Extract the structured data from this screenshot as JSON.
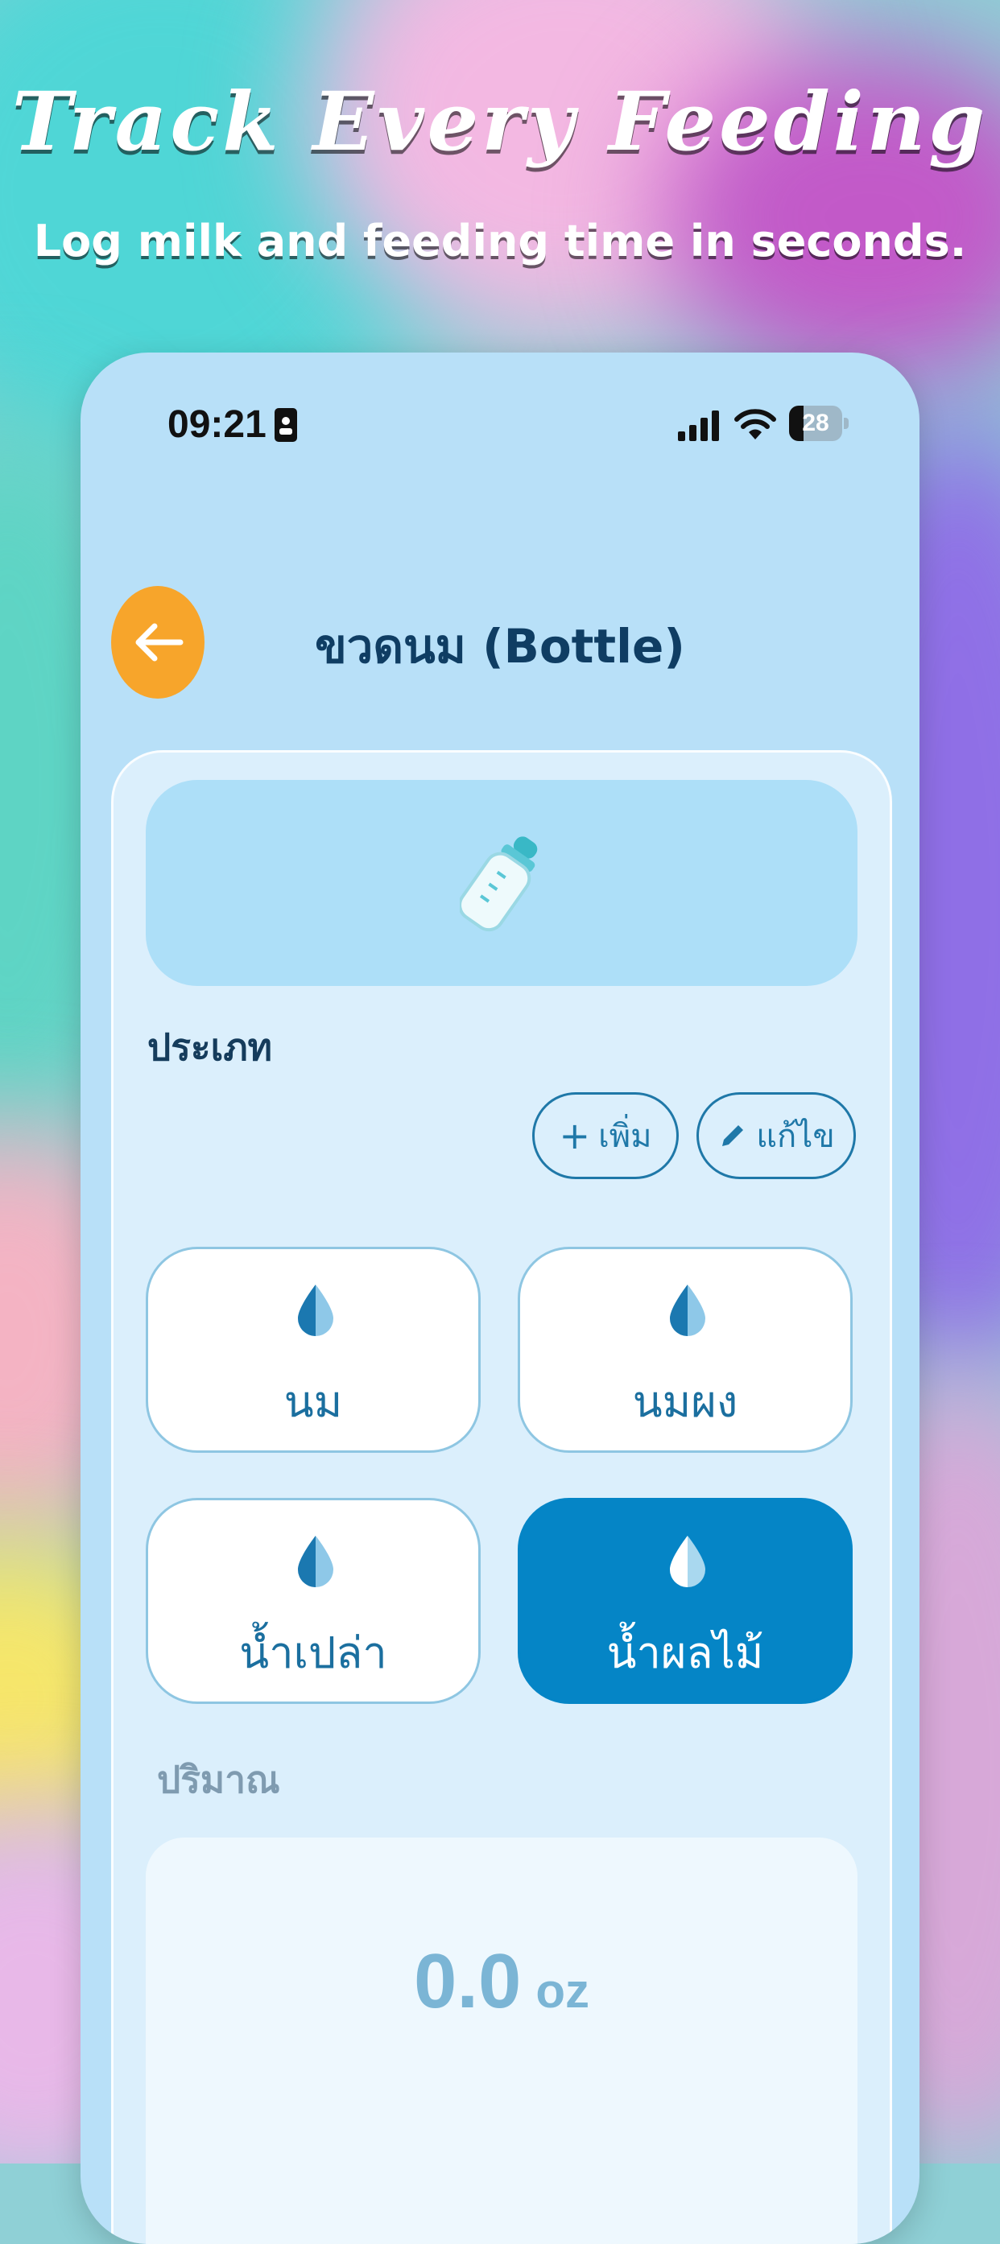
{
  "promo": {
    "title": "Track Every Feeding",
    "subtitle": "Log milk and feeding time in seconds."
  },
  "status_bar": {
    "time": "09:21",
    "battery": "28",
    "battery_level": 0.28
  },
  "header": {
    "title": "ขวดนม (Bottle)",
    "back_icon": "arrow-left-icon"
  },
  "hero": {
    "icon": "baby-bottle-icon"
  },
  "type_section": {
    "label": "ประเภท",
    "add_label": "เพิ่ม",
    "edit_label": "แก้ไข",
    "options": [
      {
        "label": "นม",
        "icon": "drop-icon",
        "selected": false
      },
      {
        "label": "นมผง",
        "icon": "drop-icon",
        "selected": false
      },
      {
        "label": "น้ำเปล่า",
        "icon": "drop-icon",
        "selected": false
      },
      {
        "label": "น้ำผลไม้",
        "icon": "drop-icon",
        "selected": true
      }
    ]
  },
  "quantity": {
    "label": "ปริมาณ",
    "value": "0.0",
    "unit": "oz"
  },
  "colors": {
    "accent": "#0585C6",
    "back_button": "#F7A52B",
    "phone_bg": "#B8E0F8"
  }
}
